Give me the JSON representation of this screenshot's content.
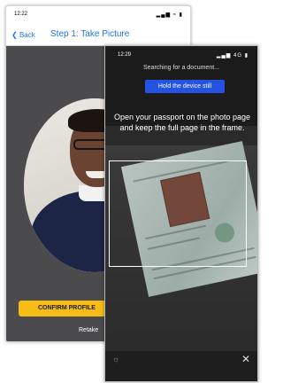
{
  "back_screen": {
    "status_time": "12:22",
    "status_icons": "▂▄▆ ≈ ▮",
    "back_label": "Back",
    "title": "Step 1: Take Picture",
    "confirm_label": "CONFIRM PROFILE",
    "retake_label": "Retake"
  },
  "front_screen": {
    "status_time": "12:29",
    "status_icons": "▂▄▆ 4G ▮",
    "searching_text": "Searching for a document...",
    "hold_label": "Hold the device still",
    "instruction": "Open your passport on the photo page and keep the full page in the frame.",
    "flash_icon": "☼",
    "close_icon": "✕"
  },
  "colors": {
    "accent_blue": "#1f73e8",
    "hold_blue": "#2453e3",
    "confirm_yellow": "#f4bc15"
  }
}
